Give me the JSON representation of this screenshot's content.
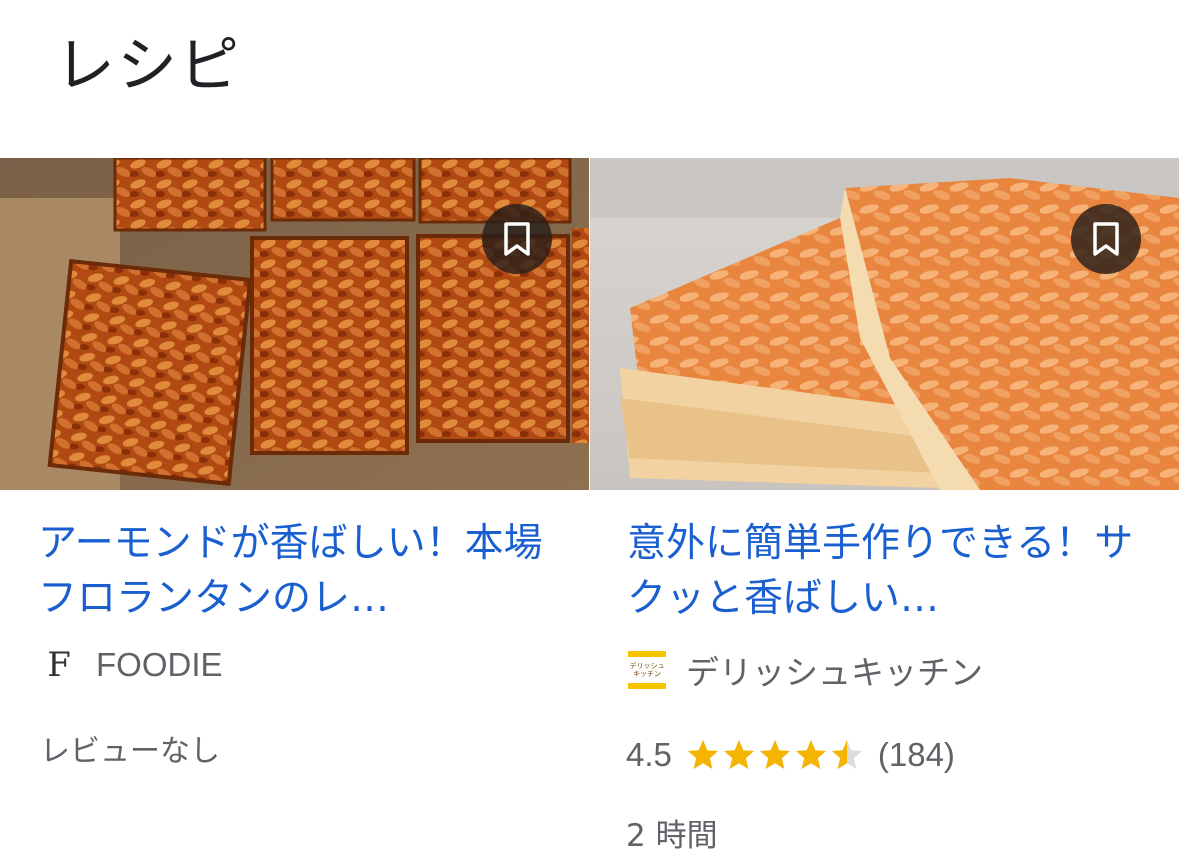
{
  "section": {
    "title": "レシピ"
  },
  "cards": [
    {
      "title": "アーモンドが香ばしい！本場フロランタンのレ…",
      "source": "FOODIE",
      "source_logo_letter": "F",
      "review": "レビューなし",
      "image": "florentine-squares-photo",
      "bookmark_icon": "bookmark-icon"
    },
    {
      "title": "意外に簡単手作りできる！サクッと香ばしい…",
      "source": "デリッシュキッチン",
      "source_logo_text": [
        "デリッシュ",
        "キッチン"
      ],
      "rating": "4.5",
      "rating_value": 4.5,
      "rating_max": 5,
      "review_count": "(184)",
      "time": "2 時間",
      "image": "florentine-slices-photo",
      "bookmark_icon": "bookmark-icon"
    }
  ],
  "colors": {
    "title_link": "#1a5fd0",
    "star": "#f4b400",
    "star_empty": "#dadce0",
    "muted_text": "#5f6368"
  }
}
